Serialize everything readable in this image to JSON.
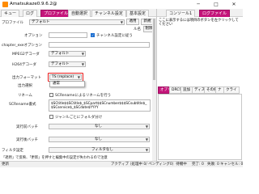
{
  "window": {
    "title": "Amatsukaze0.9.6.2@",
    "min": "─",
    "max": "□",
    "close": "✕"
  },
  "tabs": [
    {
      "label": "キュー"
    },
    {
      "label": "ログ"
    },
    {
      "label": "プロファイル"
    },
    {
      "label": "自動選択"
    },
    {
      "label": "チャンネル設定"
    },
    {
      "label": "基本設定"
    },
    {
      "label": "コンソール1"
    },
    {
      "label": "ログファイル"
    }
  ],
  "profile": {
    "label": "プロファイル",
    "value": "デフォルト"
  },
  "right_toolbar": {
    "apply": "適用",
    "new": "新規",
    "name": "ル名",
    "delete": "削除"
  },
  "help": {
    "text": "ここに表示するには項目のボタンを左クリックしてください",
    "warning_icon": "warning-icon"
  },
  "options": {
    "top_label": "オプション",
    "channel_check": "チャンネル設定に従う",
    "chapter_label": "chapter_exeオプション",
    "mpeg2_label": "MPEG2デコーダ",
    "mpeg2_value": "デフォルト",
    "h264_label": "H264デコーダ",
    "h264_value": "デフォルト",
    "output_format_label": "出力フォーマット",
    "output_format_value": "TS (replace)",
    "output_select_label": "出力選択",
    "output_select_value": "通常",
    "rename_label": "リネーム",
    "rename_check": "SCRenameによるリネームを行う",
    "screname_label": "SCRename書式",
    "screname_value": "$SCtitle$$SCtitle$_$SCpart$$SCnumber$$$SCsubtitle$_$SCservice$_$SCdate$YYYY",
    "genre_check": "ジャンルごとにフォルダ分け",
    "exec_before_label": "実行前バッチ",
    "exec_before_value": "なし",
    "exec_after_label": "実行後バッチ",
    "exec_after_value": "なし",
    "filter_label": "フィルタ設定",
    "filter_value": "フィルタなし"
  },
  "right_panel": {
    "tabs": [
      "オプリ",
      "DRCS",
      "追加",
      "ディス",
      "その他",
      "ナ",
      "クライ"
    ],
    "selected_tab": "オプリ"
  },
  "status": {
    "left": "「適用」で反映、「更新」を押すと編集中の設定が失われるので注意",
    "update": "更新",
    "active": "アクティブ",
    "bottom_right": "（処理中 0/ ペンディング0）待機中",
    "complete": "完了: 0",
    "failed": "失敗: 0",
    "cancel": "キャンセル: 0"
  },
  "colors": {
    "accent": "#c4157a",
    "highlight": "#e81a1a",
    "check": "#1e6fd0"
  }
}
